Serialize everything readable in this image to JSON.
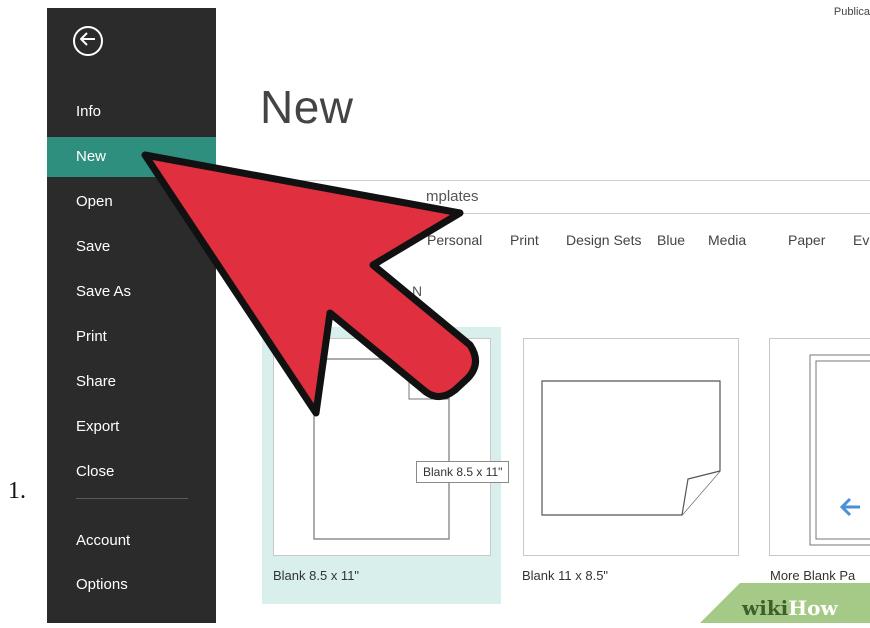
{
  "step_number": "1.",
  "app": {
    "name": "Publica"
  },
  "sidebar": {
    "items": [
      {
        "label": "Info"
      },
      {
        "label": "New"
      },
      {
        "label": "Open"
      },
      {
        "label": "Save"
      },
      {
        "label": "Save As"
      },
      {
        "label": "Print"
      },
      {
        "label": "Share"
      },
      {
        "label": "Export"
      },
      {
        "label": "Close"
      },
      {
        "label": "Account"
      },
      {
        "label": "Options"
      }
    ],
    "active": "New"
  },
  "page": {
    "title": "New",
    "search_text": "mplates",
    "categories": [
      "Personal",
      "Print",
      "Design Sets",
      "Blue",
      "Media",
      "Paper",
      "Ev"
    ],
    "section_label": "N"
  },
  "templates": [
    {
      "label": "Blank 8.5 x 11\""
    },
    {
      "label": "Blank 11 x 8.5\""
    },
    {
      "label": "More Blank Pa"
    }
  ],
  "tooltip": "Blank 8.5 x 11\"",
  "watermark": {
    "wiki": "wiki",
    "how": "How"
  },
  "colors": {
    "sidebar_bg": "#2b2b2b",
    "accent": "#2e8f7e",
    "selected_tile": "#d8efec",
    "arrow_fill": "#e03040",
    "more_blank_arrow": "#4a90d9",
    "watermark_green": "#9bc47a"
  }
}
